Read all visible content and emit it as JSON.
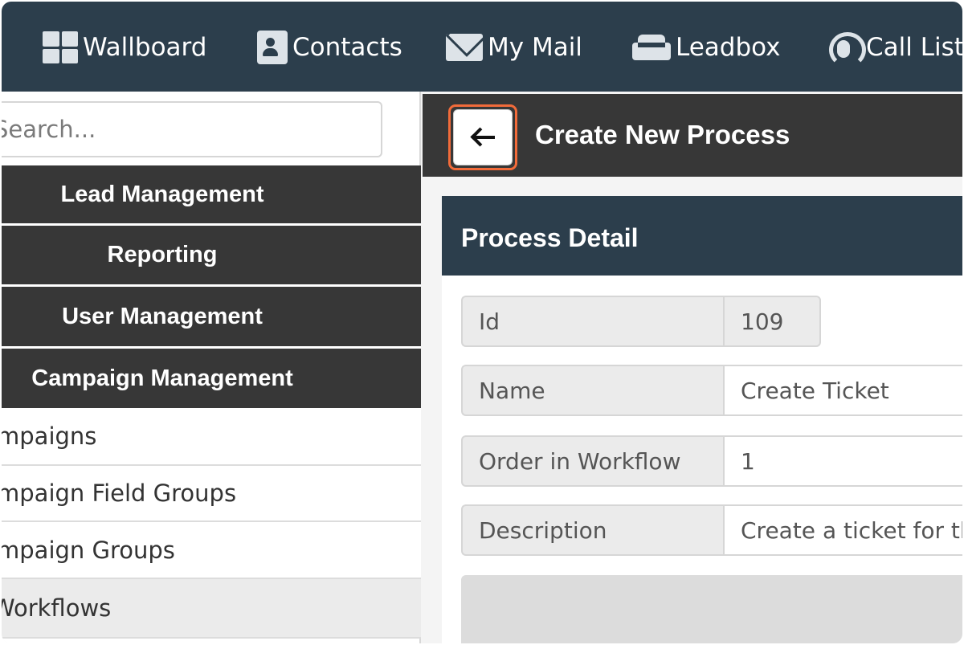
{
  "navbar": {
    "items": [
      {
        "label": "Wallboard",
        "icon": "wallboard-icon"
      },
      {
        "label": "Contacts",
        "icon": "contacts-icon"
      },
      {
        "label": "My Mail",
        "icon": "mail-icon"
      },
      {
        "label": "Leadbox",
        "icon": "leadbox-icon"
      },
      {
        "label": "Call List",
        "icon": "headset-icon"
      }
    ]
  },
  "sidebar": {
    "search_placeholder": "Search...",
    "sections": [
      {
        "label": "Lead Management"
      },
      {
        "label": "Reporting"
      },
      {
        "label": "User Management"
      },
      {
        "label": "Campaign Management"
      }
    ],
    "items": [
      {
        "label": "Campaigns",
        "active": false
      },
      {
        "label": "Campaign Field Groups",
        "active": false
      },
      {
        "label": "Campaign Groups",
        "active": false
      },
      {
        "label": "Workflows",
        "active": true
      }
    ]
  },
  "page": {
    "title": "Create New Process",
    "back_icon": "arrow-left-icon",
    "highlight_color": "#f26b3a"
  },
  "panel": {
    "title": "Process Detail",
    "fields": [
      {
        "label": "Id",
        "value": "109",
        "readonly": true
      },
      {
        "label": "Name",
        "value": "Create Ticket",
        "readonly": false
      },
      {
        "label": "Order in Workflow",
        "value": "1",
        "readonly": false
      },
      {
        "label": "Description",
        "value": "Create a ticket for the",
        "readonly": false
      }
    ]
  },
  "colors": {
    "navbar_bg": "#2c3e4c",
    "sidebar_section_bg": "#373737",
    "panel_header_bg": "#2c3e4c"
  }
}
